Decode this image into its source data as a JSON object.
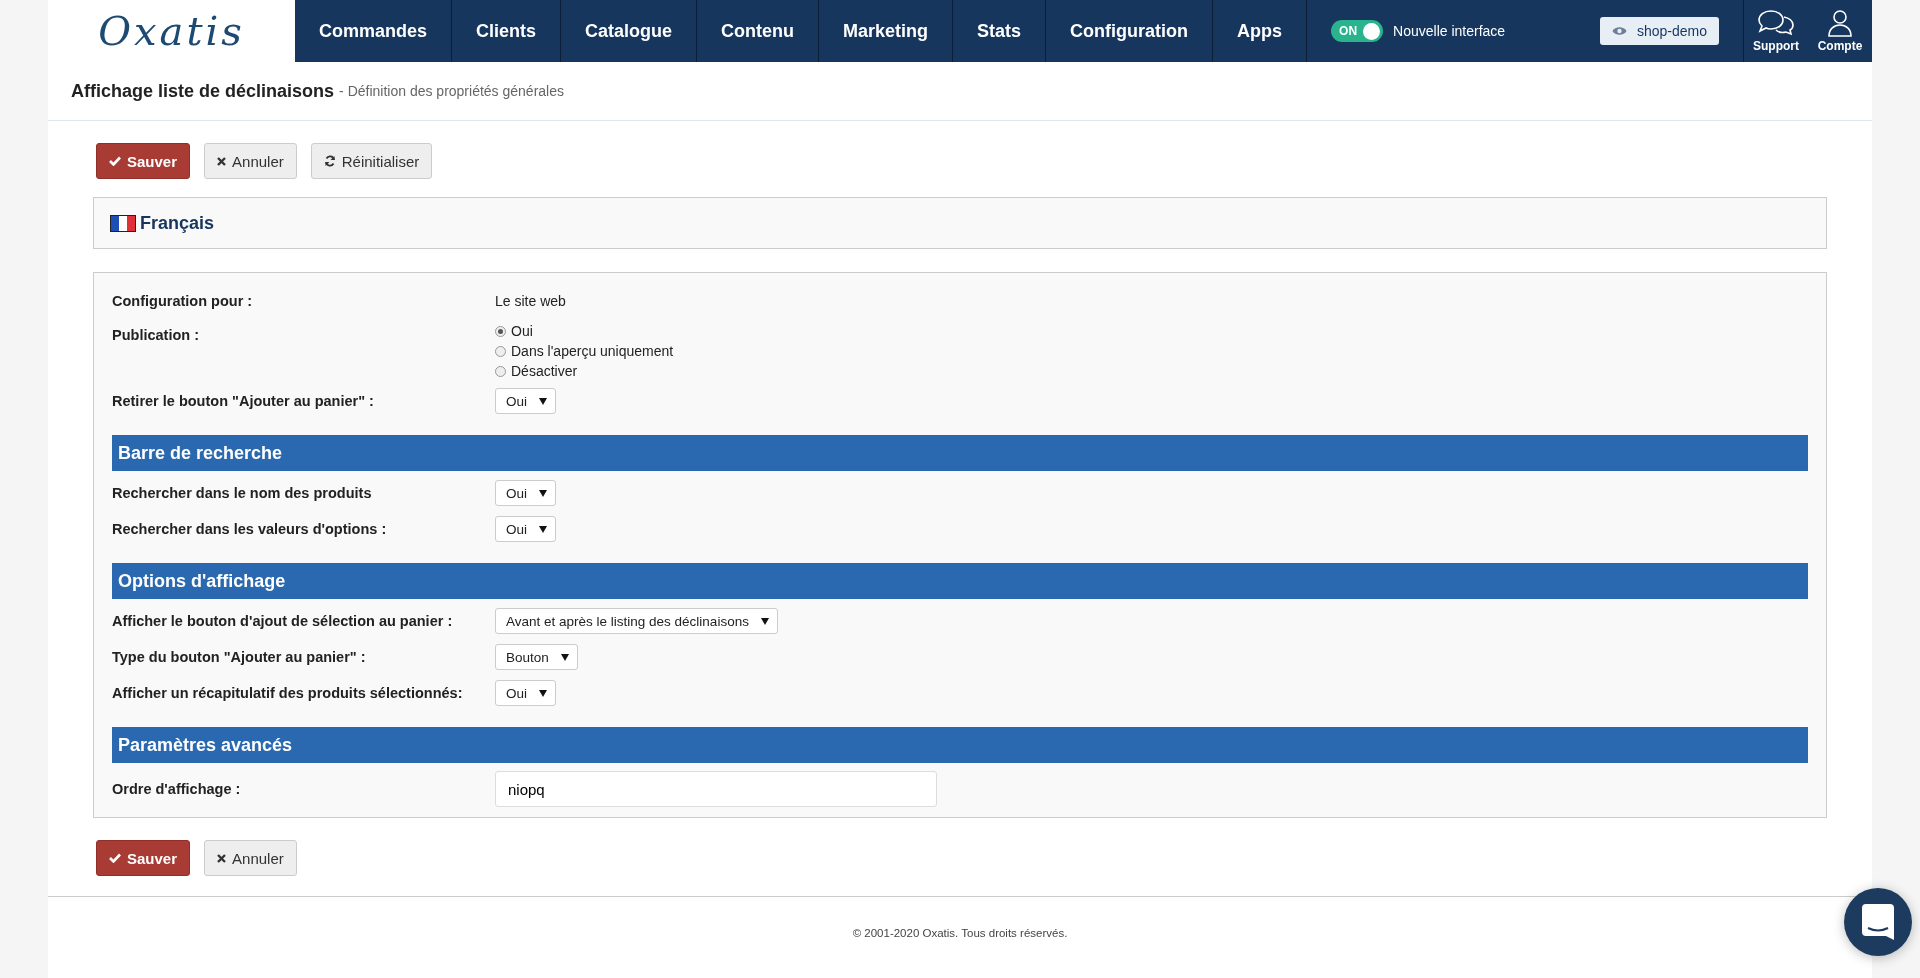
{
  "nav": {
    "logo": "Oxatis",
    "items": [
      {
        "label": "Commandes"
      },
      {
        "label": "Clients"
      },
      {
        "label": "Catalogue"
      },
      {
        "label": "Contenu"
      },
      {
        "label": "Marketing"
      },
      {
        "label": "Stats"
      },
      {
        "label": "Configuration"
      },
      {
        "label": "Apps"
      }
    ],
    "toggle": {
      "label": "ON",
      "on": true,
      "caption": "Nouvelle interface"
    },
    "shop_button": "shop-demo",
    "actions": [
      {
        "label": "Support",
        "kind": "support"
      },
      {
        "label": "Compte",
        "kind": "account"
      }
    ]
  },
  "header": {
    "title": "Affichage liste de déclinaisons",
    "subtitle": "- Définition des propriétés générales"
  },
  "top_buttons": [
    {
      "label": "Sauver",
      "kind": "save"
    },
    {
      "label": "Annuler",
      "kind": "cancel"
    },
    {
      "label": "Réinitialiser",
      "kind": "reset"
    }
  ],
  "language": "Français",
  "form": {
    "rows": [
      {
        "kind": "text",
        "label": "Configuration pour :",
        "value": "Le site web"
      },
      {
        "kind": "radio",
        "label": "Publication :",
        "options": [
          {
            "label": "Oui",
            "selected": true
          },
          {
            "label": "Dans l'aperçu uniquement",
            "selected": false
          },
          {
            "label": "Désactiver",
            "selected": false
          }
        ]
      },
      {
        "kind": "select",
        "label": "Retirer le bouton \"Ajouter au panier\" :",
        "value": "Oui"
      },
      {
        "kind": "section",
        "label": "Barre de recherche"
      },
      {
        "kind": "select",
        "label": "Rechercher dans le nom des produits",
        "value": "Oui"
      },
      {
        "kind": "select",
        "label": "Rechercher dans les valeurs d'options :",
        "value": "Oui"
      },
      {
        "kind": "section",
        "label": "Options d'affichage"
      },
      {
        "kind": "select",
        "label": "Afficher le bouton d'ajout de sélection au panier :",
        "value": "Avant et après le listing des déclinaisons"
      },
      {
        "kind": "select",
        "label": "Type du bouton \"Ajouter au panier\" :",
        "value": "Bouton"
      },
      {
        "kind": "select",
        "label": "Afficher un récapitulatif des produits sélectionnés:",
        "value": "Oui"
      },
      {
        "kind": "section",
        "label": "Paramètres avancés"
      },
      {
        "kind": "input",
        "label": "Ordre d'affichage :",
        "value": "niopq"
      }
    ]
  },
  "bottom_buttons": [
    {
      "label": "Sauver",
      "kind": "save"
    },
    {
      "label": "Annuler",
      "kind": "cancel"
    }
  ],
  "footer": "© 2001-2020 Oxatis. Tous droits réservés."
}
